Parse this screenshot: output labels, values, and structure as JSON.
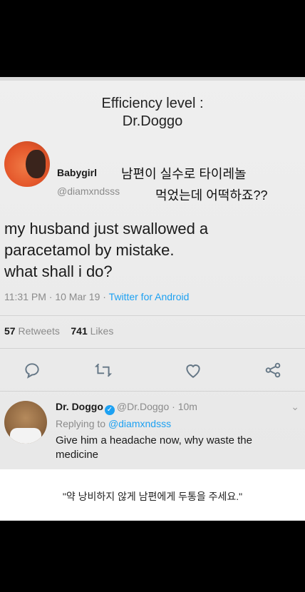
{
  "title": {
    "line1": "Efficiency level :",
    "line2": "Dr.Doggo"
  },
  "tweet": {
    "author_name": "Babygirl",
    "author_handle": "@diamxndsss",
    "korean_overlay_line1": "남편이 실수로  타이레놀",
    "korean_overlay_line2": "먹었는데 어떡하죠??",
    "text_line1": "my husband just swallowed a",
    "text_line2": "paracetamol by mistake.",
    "text_line3": "what shall i do?",
    "time": "11:31 PM · 10 Mar 19 · ",
    "source": "Twitter for Android",
    "retweets_count": "57",
    "retweets_label": "Retweets",
    "likes_count": "741",
    "likes_label": "Likes"
  },
  "actions": [
    {
      "icon": "reply-icon"
    },
    {
      "icon": "retweet-icon"
    },
    {
      "icon": "like-icon"
    },
    {
      "icon": "share-icon"
    }
  ],
  "reply": {
    "author_name": "Dr. Doggo",
    "verified_mark": "✓",
    "author_handle": "@Dr.Doggo · 10m",
    "chevron": "⌄",
    "replying_prefix": "Replying to ",
    "replying_to": "@diamxndsss",
    "text": "Give him a headache now, why waste the medicine"
  },
  "caption": "\"약 낭비하지 않게 남편에게 두통을 주세요.\""
}
